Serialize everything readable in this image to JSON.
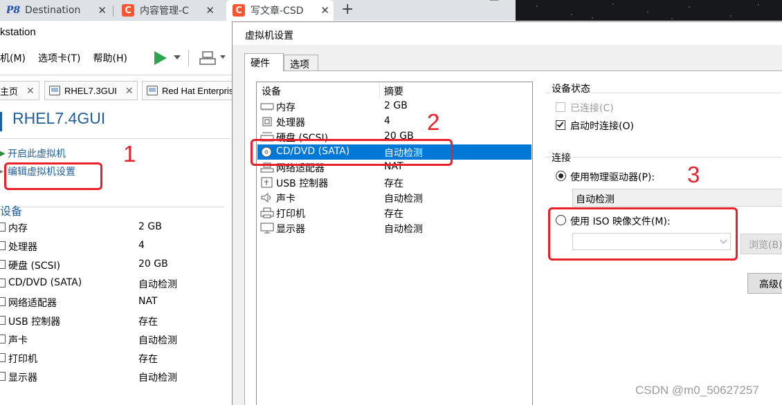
{
  "browser": {
    "tabs": [
      {
        "title": "Destination",
        "icon": "ps-icon"
      },
      {
        "title": "内容管理-C",
        "icon": "csdn-icon"
      },
      {
        "title": "写文章-CSD",
        "icon": "csdn-icon"
      }
    ],
    "new_tab_symbol": "+",
    "close_symbol": "✕",
    "minimize_symbol": "—"
  },
  "workstation": {
    "title": "kstation",
    "menu": [
      "机(M)",
      "选项卡(T)",
      "帮助(H)"
    ],
    "vm_tabs": [
      {
        "label": "主页"
      },
      {
        "label": "RHEL7.3GUI"
      },
      {
        "label": "Red Hat Enterprise"
      }
    ],
    "vm_name": "RHEL7.4GUI",
    "actions": [
      {
        "label": "开启此虚拟机"
      },
      {
        "label": "编辑虚拟机设置"
      }
    ],
    "devices_heading": "设备",
    "devices": [
      {
        "name": "内存",
        "value": "2 GB"
      },
      {
        "name": "处理器",
        "value": "4"
      },
      {
        "name": "硬盘 (SCSI)",
        "value": "20 GB"
      },
      {
        "name": "CD/DVD (SATA)",
        "value": "自动检测"
      },
      {
        "name": "网络适配器",
        "value": "NAT"
      },
      {
        "name": "USB 控制器",
        "value": "存在"
      },
      {
        "name": "声卡",
        "value": "自动检测"
      },
      {
        "name": "打印机",
        "value": "存在"
      },
      {
        "name": "显示器",
        "value": "自动检测"
      }
    ]
  },
  "annotations": {
    "n1": "1",
    "n2": "2",
    "n3": "3"
  },
  "dialog": {
    "title": "虚拟机设置",
    "tabs": [
      "硬件",
      "选项"
    ],
    "list_headers": {
      "device": "设备",
      "summary": "摘要"
    },
    "hardware": [
      {
        "name": "内存",
        "summary": "2 GB",
        "icon": "memory-icon"
      },
      {
        "name": "处理器",
        "summary": "4",
        "icon": "cpu-icon"
      },
      {
        "name": "硬盘 (SCSI)",
        "summary": "20 GB",
        "icon": "harddisk-icon"
      },
      {
        "name": "CD/DVD (SATA)",
        "summary": "自动检测",
        "icon": "cdrom-icon",
        "selected": true
      },
      {
        "name": "网络适配器",
        "summary": "NAT",
        "icon": "network-icon"
      },
      {
        "name": "USB 控制器",
        "summary": "存在",
        "icon": "usb-icon"
      },
      {
        "name": "声卡",
        "summary": "自动检测",
        "icon": "speaker-icon"
      },
      {
        "name": "打印机",
        "summary": "存在",
        "icon": "printer-icon"
      },
      {
        "name": "显示器",
        "summary": "自动检测",
        "icon": "monitor-icon"
      }
    ],
    "device_status": {
      "heading": "设备状态",
      "connected_label": "已连接(C)",
      "connected_checked": false,
      "connected_disabled": true,
      "connect_at_power_on_label": "启动时连接(O)",
      "connect_at_power_on_checked": true
    },
    "connection": {
      "heading": "连接",
      "physical_label": "使用物理驱动器(P):",
      "physical_selected": true,
      "physical_value": "自动检测",
      "iso_label": "使用 ISO 映像文件(M):",
      "iso_selected": false,
      "iso_value": "",
      "browse_label": "浏览(B)",
      "advanced_label": "高级("
    }
  },
  "watermark": "CSDN @m0_50627257",
  "colors": {
    "accent_blue": "#1f5e9b",
    "selection": "#0078d7",
    "annotation_red": "#e8202a",
    "csdn_orange": "#fc5531"
  }
}
